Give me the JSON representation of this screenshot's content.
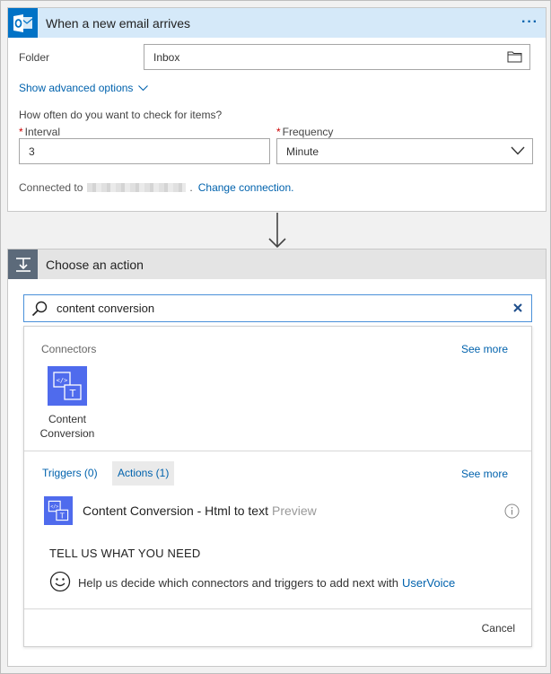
{
  "trigger": {
    "title": "When a new email arrives",
    "more_label": "···",
    "folder_label": "Folder",
    "folder_value": "Inbox",
    "advanced_label": "Show advanced options",
    "question": "How often do you want to check for items?",
    "interval_label": "Interval",
    "interval_value": "3",
    "frequency_label": "Frequency",
    "frequency_value": "Minute",
    "required_mark": "*",
    "connected_prefix": "Connected to",
    "connected_suffix": ".",
    "change_link": "Change connection."
  },
  "action": {
    "title": "Choose an action",
    "search_value": "content conversion",
    "connectors_title": "Connectors",
    "see_more": "See more",
    "connector_name": "Content Conversion",
    "tab_triggers": "Triggers (0)",
    "tab_actions": "Actions (1)",
    "action_item": "Content Conversion - Html to text",
    "action_item_tag": "Preview",
    "tell_us": "TELL US WHAT YOU NEED",
    "feedback_text": "Help us decide which connectors and triggers to add next with",
    "uservoice_link": "UserVoice",
    "cancel_label": "Cancel"
  },
  "colors": {
    "outlook_blue": "#0072c6",
    "link_blue": "#0062ad",
    "connector_blue": "#4f6bed",
    "trigger_header_bg": "#d5e9f9",
    "action_header_bg": "#e4e4e4"
  },
  "icons": {
    "trigger": "outlook-icon",
    "action": "choose-action-icon",
    "search": "search-icon",
    "clear": "close-icon",
    "connector": "content-conversion-icon",
    "info": "info-icon",
    "feedback": "smiley-icon",
    "folder": "folder-icon",
    "dropdown": "chevron-down-icon"
  }
}
